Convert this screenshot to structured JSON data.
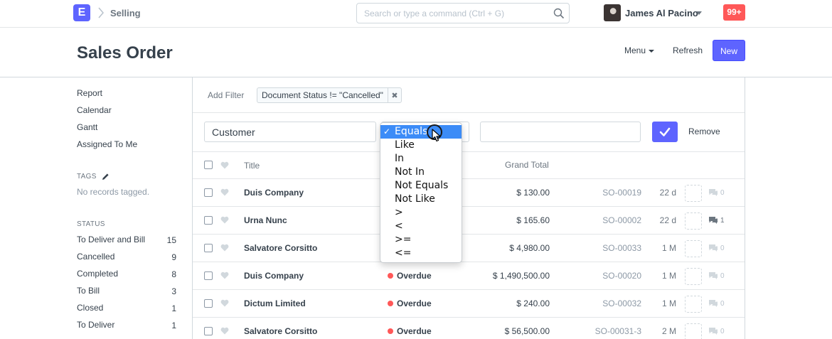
{
  "navbar": {
    "logo_letter": "E",
    "breadcrumb": "Selling",
    "search_placeholder": "Search or type a command (Ctrl + G)",
    "user_name": "James Al Pacino",
    "notifications": "99+"
  },
  "page": {
    "title": "Sales Order",
    "menu_label": "Menu",
    "refresh_label": "Refresh",
    "new_label": "New"
  },
  "sidebar": {
    "views": [
      "Report",
      "Calendar",
      "Gantt",
      "Assigned To Me"
    ],
    "tags_heading": "TAGS",
    "tags_empty": "No records tagged.",
    "status_heading": "STATUS",
    "statuses": [
      {
        "label": "To Deliver and Bill",
        "count": "15"
      },
      {
        "label": "Cancelled",
        "count": "9"
      },
      {
        "label": "Completed",
        "count": "8"
      },
      {
        "label": "To Bill",
        "count": "3"
      },
      {
        "label": "Closed",
        "count": "1"
      },
      {
        "label": "To Deliver",
        "count": "1"
      }
    ]
  },
  "filters": {
    "add_filter_label": "Add Filter",
    "active_filter": "Document Status != \"Cancelled\"",
    "editor_field": "Customer",
    "editor_remove": "Remove"
  },
  "condition_dropdown": {
    "selected": "Equals",
    "options": [
      "Equals",
      "Like",
      "In",
      "Not In",
      "Not Equals",
      "Not Like",
      ">",
      "<",
      ">=",
      "<="
    ]
  },
  "list": {
    "columns": {
      "title": "Title",
      "grand_total": "Grand Total"
    },
    "rows": [
      {
        "title": "Duis Company",
        "status": "",
        "total": "$ 130.00",
        "name": "SO-00019",
        "age": "22 d",
        "comments": "0"
      },
      {
        "title": "Urna Nunc",
        "status": "",
        "total": "$ 165.60",
        "name": "SO-00002",
        "age": "22 d",
        "comments": "1"
      },
      {
        "title": "Salvatore Corsitto",
        "status": "",
        "total": "$ 4,980.00",
        "name": "SO-00033",
        "age": "1 M",
        "comments": "0"
      },
      {
        "title": "Duis Company",
        "status": "Overdue",
        "total": "$ 1,490,500.00",
        "name": "SO-00020",
        "age": "1 M",
        "comments": "0"
      },
      {
        "title": "Dictum Limited",
        "status": "Overdue",
        "total": "$ 240.00",
        "name": "SO-00032",
        "age": "1 M",
        "comments": "0"
      },
      {
        "title": "Salvatore Corsitto",
        "status": "Overdue",
        "total": "$ 56,500.00",
        "name": "SO-00031-3",
        "age": "2 M",
        "comments": "0"
      }
    ]
  },
  "colors": {
    "primary": "#5e64ff",
    "danger": "#ff5858",
    "dropdown_highlight": "#3c8cf7"
  }
}
